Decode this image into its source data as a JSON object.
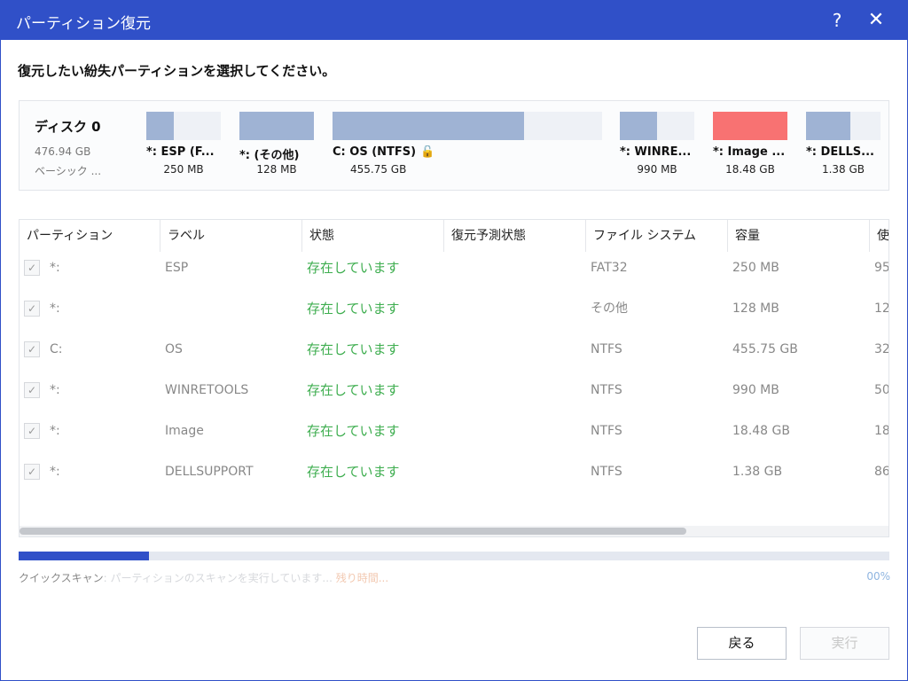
{
  "window": {
    "title": "パーティション復元",
    "help_icon": "?",
    "close_icon": "✕"
  },
  "instruction": "復元したい紛失パーティションを選択してください。",
  "disk": {
    "name": "ディスク 0",
    "size": "476.94 GB",
    "type": "ベーシック ...",
    "partitions": [
      {
        "label": "*: ESP (F...",
        "size": "250 MB",
        "used_fraction": 0.37,
        "color": "#9fb3d4"
      },
      {
        "label": "*: (その他)",
        "size": "128 MB",
        "used_fraction": 1.0,
        "color": "#9fb3d4"
      },
      {
        "label": "C: OS (NTFS)",
        "size": "455.75 GB",
        "used_fraction": 0.71,
        "color": "#9fb3d4",
        "locked": true,
        "lock_icon": "🔓"
      },
      {
        "label": "*: WINRE...",
        "size": "990 MB",
        "used_fraction": 0.5,
        "color": "#9fb3d4"
      },
      {
        "label": "*: Image ...",
        "size": "18.48 GB",
        "used_fraction": 1.0,
        "color": "#f87272"
      },
      {
        "label": "*: DELLS...",
        "size": "1.38 GB",
        "used_fraction": 0.6,
        "color": "#9fb3d4"
      }
    ]
  },
  "table": {
    "columns": [
      "パーティション",
      "ラベル",
      "状態",
      "復元予測状態",
      "ファイル システム",
      "容量",
      "使"
    ],
    "rows": [
      {
        "checked": "✓",
        "partition": "*:",
        "label": "ESP",
        "status": "存在しています",
        "prediction": "",
        "fs": "FAT32",
        "capacity": "250 MB",
        "used": "95"
      },
      {
        "checked": "✓",
        "partition": "*:",
        "label": "",
        "status": "存在しています",
        "prediction": "",
        "fs": "その他",
        "capacity": "128 MB",
        "used": "12"
      },
      {
        "checked": "✓",
        "partition": "C:",
        "label": "OS",
        "status": "存在しています",
        "prediction": "",
        "fs": "NTFS",
        "capacity": "455.75 GB",
        "used": "32"
      },
      {
        "checked": "✓",
        "partition": "*:",
        "label": "WINRETOOLS",
        "status": "存在しています",
        "prediction": "",
        "fs": "NTFS",
        "capacity": "990 MB",
        "used": "50"
      },
      {
        "checked": "✓",
        "partition": "*:",
        "label": "Image",
        "status": "存在しています",
        "prediction": "",
        "fs": "NTFS",
        "capacity": "18.48 GB",
        "used": "18"
      },
      {
        "checked": "✓",
        "partition": "*:",
        "label": "DELLSUPPORT",
        "status": "存在しています",
        "prediction": "",
        "fs": "NTFS",
        "capacity": "1.38 GB",
        "used": "86"
      }
    ]
  },
  "scan": {
    "text_prefix": "クイックスキャン",
    "text_faded": ": パーティションのスキャンを実行しています...",
    "text_extra": "残り時間...",
    "progress": 0.15,
    "percent": "00%"
  },
  "buttons": {
    "back": "戻る",
    "run": "実行"
  },
  "colors": {
    "titlebar": "#3050c8",
    "status_ok": "#3fae50",
    "accent_lock": "#2f8ee3"
  }
}
